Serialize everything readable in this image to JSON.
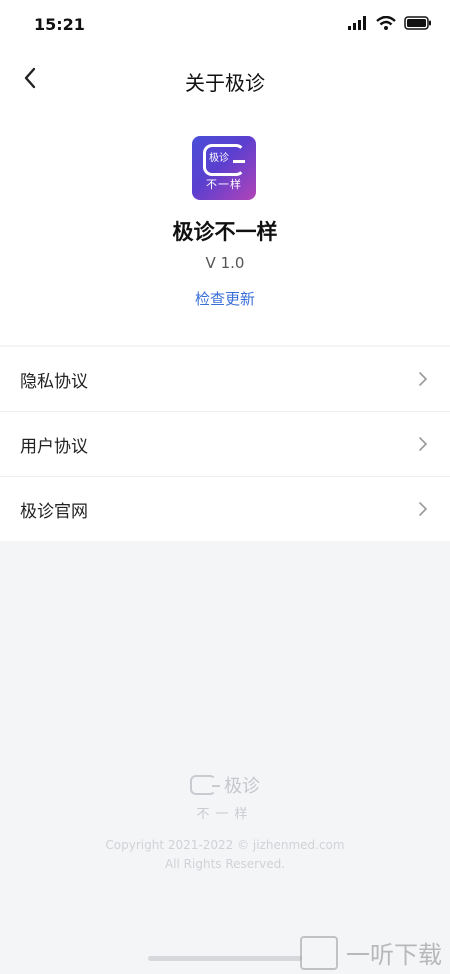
{
  "status_bar": {
    "time": "15:21"
  },
  "nav": {
    "title": "关于极诊"
  },
  "app": {
    "icon_text_top": "极诊",
    "icon_text_bottom": "不一样",
    "name": "极诊不一样",
    "version": "V 1.0",
    "check_update": "检查更新"
  },
  "menu": {
    "items": [
      {
        "label": "隐私协议"
      },
      {
        "label": "用户协议"
      },
      {
        "label": "极诊官网"
      }
    ]
  },
  "footer": {
    "brand": "极诊",
    "slogan": "不一样",
    "copyright_line1": "Copyright 2021-2022 © jizhenmed.com",
    "copyright_line2": "All Rights Reserved."
  },
  "watermark": {
    "text": "一听下载"
  },
  "colors": {
    "accent": "#3a6fd8",
    "icon_gradient_start": "#4a4fd8",
    "icon_gradient_end": "#b244b8"
  }
}
